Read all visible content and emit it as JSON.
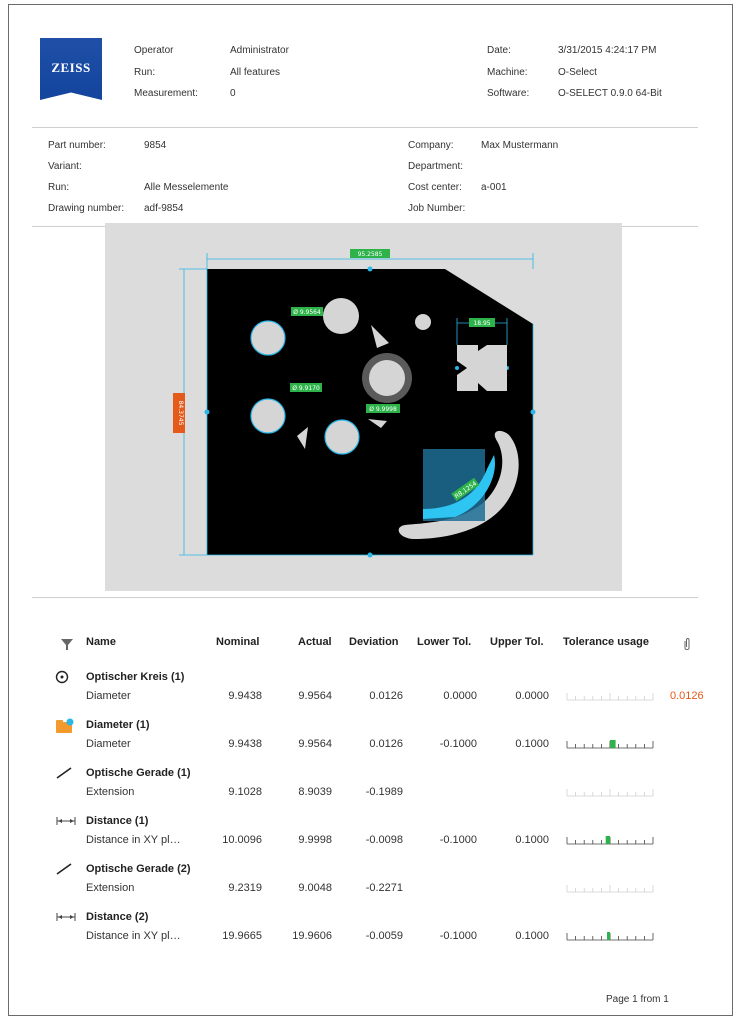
{
  "header": {
    "logo_text": "ZEISS",
    "operator_label": "Operator",
    "operator_value": "Administrator",
    "run_label": "Run:",
    "run_value": "All features",
    "measurement_label": "Measurement:",
    "measurement_value": "0",
    "date_label": "Date:",
    "date_value": "3/31/2015 4:24:17 PM",
    "machine_label": "Machine:",
    "machine_value": "O-Select",
    "software_label": "Software:",
    "software_value": "O-SELECT 0.9.0 64-Bit"
  },
  "part": {
    "part_number_label": "Part number:",
    "part_number_value": "9854",
    "variant_label": "Variant:",
    "variant_value": "",
    "run_label": "Run:",
    "run_value": "Alle Messelemente",
    "drawing_label": "Drawing number:",
    "drawing_value": "adf-9854",
    "company_label": "Company:",
    "company_value": "Max Mustermann",
    "department_label": "Department:",
    "department_value": "",
    "cost_center_label": "Cost center:",
    "cost_center_value": "a-001",
    "job_label": "Job Number:",
    "job_value": ""
  },
  "drawing": {
    "dim_top": "95.2585",
    "dim_left": "84.3745",
    "dim_right": "18.95",
    "dim_c1": "Ø 9.9564",
    "dim_c2": "Ø 9.9170",
    "dim_c3": "Ø 9.9998",
    "dim_arc": "R8.1254"
  },
  "columns": {
    "name": "Name",
    "nominal": "Nominal",
    "actual": "Actual",
    "deviation": "Deviation",
    "lower": "Lower Tol.",
    "upper": "Upper Tol.",
    "usage": "Tolerance usage"
  },
  "rows": [
    {
      "title": "Optischer Kreis (1)",
      "icon": "circle-target-icon",
      "sub": "Diameter",
      "nominal": "9.9438",
      "actual": "9.9564",
      "deviation": "0.0126",
      "lower": "0.0000",
      "upper": "0.0000",
      "usage_fraction": null,
      "flag": "0.0126",
      "flag_color": "#e35a1b"
    },
    {
      "title": "Diameter (1)",
      "icon": "folder-check-icon",
      "sub": "Diameter",
      "nominal": "9.9438",
      "actual": "9.9564",
      "deviation": "0.0126",
      "lower": "-0.1000",
      "upper": "0.1000",
      "usage_fraction": 0.13,
      "flag": "",
      "flag_color": ""
    },
    {
      "title": "Optische Gerade (1)",
      "icon": "line-icon",
      "sub": "Extension",
      "nominal": "9.1028",
      "actual": "8.9039",
      "deviation": "-0.1989",
      "lower": "",
      "upper": "",
      "usage_fraction": null,
      "flag": "",
      "flag_color": ""
    },
    {
      "title": "Distance (1)",
      "icon": "distance-icon",
      "sub": "Distance in XY pl…",
      "nominal": "10.0096",
      "actual": "9.9998",
      "deviation": "-0.0098",
      "lower": "-0.1000",
      "upper": "0.1000",
      "usage_fraction": -0.1,
      "flag": "",
      "flag_color": ""
    },
    {
      "title": "Optische Gerade (2)",
      "icon": "line-icon",
      "sub": "Extension",
      "nominal": "9.2319",
      "actual": "9.0048",
      "deviation": "-0.2271",
      "lower": "",
      "upper": "",
      "usage_fraction": null,
      "flag": "",
      "flag_color": ""
    },
    {
      "title": "Distance (2)",
      "icon": "distance-icon",
      "sub": "Distance in XY pl…",
      "nominal": "19.9665",
      "actual": "19.9606",
      "deviation": "-0.0059",
      "lower": "-0.1000",
      "upper": "0.1000",
      "usage_fraction": -0.06,
      "flag": "",
      "flag_color": ""
    }
  ],
  "footer": {
    "page_text": "Page 1 from 1"
  },
  "colors": {
    "accent_green": "#2db34a",
    "accent_blue": "#29b6e8",
    "warning": "#e35a1b",
    "logo_blue": "#1f4fa6"
  }
}
